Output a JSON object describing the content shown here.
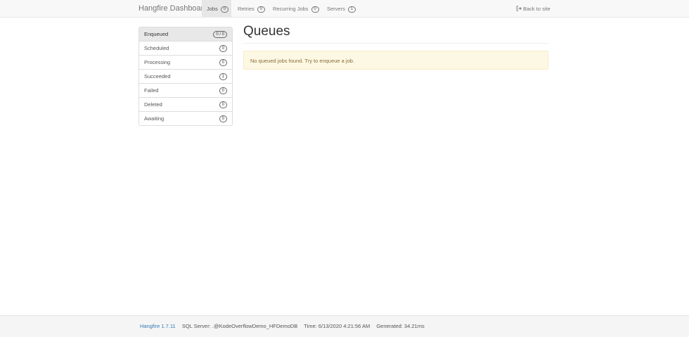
{
  "navbar": {
    "brand": "Hangfire Dashboard",
    "items": [
      {
        "label": "Jobs",
        "badge": "0",
        "active": true
      },
      {
        "label": "Retries",
        "badge": "0"
      },
      {
        "label": "Recurring Jobs",
        "badge": "0"
      },
      {
        "label": "Servers",
        "badge": "1"
      }
    ],
    "back_link": "Back to site",
    "back_icon": "sign-out-icon"
  },
  "sidebar": {
    "items": [
      {
        "label": "Enqueued",
        "badge": "0 / 0",
        "active": true
      },
      {
        "label": "Scheduled",
        "badge": "0"
      },
      {
        "label": "Processing",
        "badge": "0"
      },
      {
        "label": "Succeeded",
        "badge": "1"
      },
      {
        "label": "Failed",
        "badge": "0"
      },
      {
        "label": "Deleted",
        "badge": "0"
      },
      {
        "label": "Awaiting",
        "badge": "0"
      }
    ]
  },
  "main": {
    "title": "Queues",
    "alert": "No queued jobs found. Try to enqueue a job."
  },
  "footer": {
    "version": "Hangfire 1.7.11",
    "storage": "SQL Server: .@KodeOverflowDemo_HFDemoDB",
    "time": "Time: 6/13/2020 4:21:56 AM",
    "generated": "Generated: 34.21ms"
  },
  "colors": {
    "navbar_bg": "#f8f8f8",
    "active_bg": "#e7e7e7",
    "alert_bg": "#fcf8e3",
    "alert_text": "#8a6d3b",
    "link": "#337ab7",
    "footer_bg": "#f5f5f5"
  }
}
